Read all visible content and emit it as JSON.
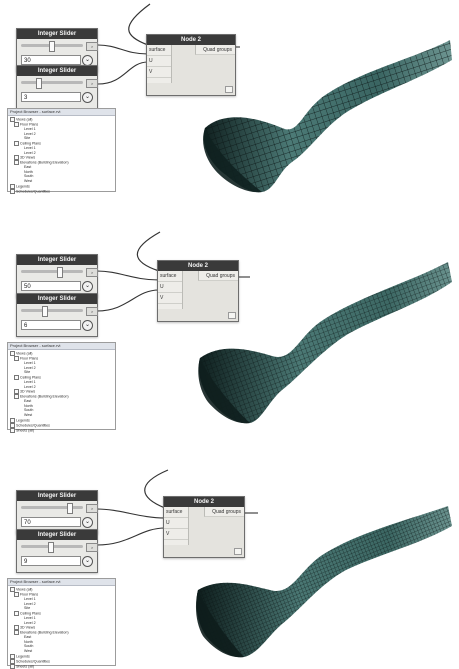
{
  "panels": [
    {
      "slider1": {
        "title": "Integer Slider",
        "value": "30",
        "fraction": 0.45
      },
      "slider2": {
        "title": "Integer Slider",
        "value": "3",
        "fraction": 0.25
      },
      "node": {
        "title": "Node 2",
        "input_surface": "surface",
        "input_u": "U",
        "input_v": "V",
        "output": "Quad groups"
      },
      "browser": {
        "title": "Project Browser - surface.rvt",
        "items": [
          "Views (all)",
          "Floor Plans",
          "Level 1",
          "Level 2",
          "Site",
          "Ceiling Plans",
          "Level 1",
          "Level 2",
          "3D Views",
          "Elevations (Building Elevation)",
          "East",
          "North",
          "South",
          "West",
          "Legends",
          "Schedules/Quantities"
        ]
      }
    },
    {
      "slider1": {
        "title": "Integer Slider",
        "value": "50",
        "fraction": 0.6
      },
      "slider2": {
        "title": "Integer Slider",
        "value": "6",
        "fraction": 0.35
      },
      "node": {
        "title": "Node 2",
        "input_surface": "surface",
        "input_u": "U",
        "input_v": "V",
        "output": "Quad groups"
      },
      "browser": {
        "title": "Project Browser - surface.rvt",
        "items": [
          "Views (all)",
          "Floor Plans",
          "Level 1",
          "Level 2",
          "Site",
          "Ceiling Plans",
          "Level 1",
          "Level 2",
          "3D Views",
          "Elevations (Building Elevation)",
          "East",
          "North",
          "South",
          "West",
          "Legends",
          "Schedules/Quantities",
          "Sheets (all)"
        ]
      }
    },
    {
      "slider1": {
        "title": "Integer Slider",
        "value": "70",
        "fraction": 0.75
      },
      "slider2": {
        "title": "Integer Slider",
        "value": "9",
        "fraction": 0.45
      },
      "node": {
        "title": "Node 2",
        "input_surface": "surface",
        "input_u": "U",
        "input_v": "V",
        "output": "Quad groups"
      },
      "browser": {
        "title": "Project Browser - surface.rvt",
        "items": [
          "Views (all)",
          "Floor Plans",
          "Level 1",
          "Level 2",
          "Site",
          "Ceiling Plans",
          "Level 1",
          "Level 2",
          "3D Views",
          "Elevations (Building Elevation)",
          "East",
          "North",
          "South",
          "West",
          "Legends",
          "Schedules/Quantities",
          "Sheets (all)"
        ]
      }
    }
  ],
  "colors": {
    "surface": "#3f6a68",
    "surface_dark": "#172826",
    "grid_line": "#0a1413",
    "node_header": "#3a3a3a"
  },
  "icons": {
    "dropdown": "chevron-down-icon"
  }
}
